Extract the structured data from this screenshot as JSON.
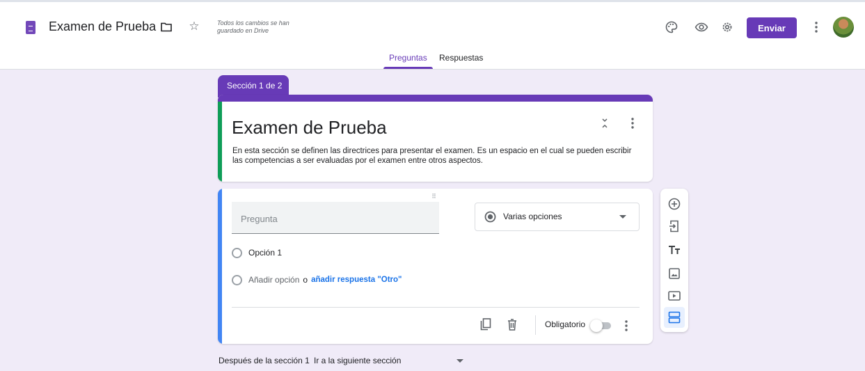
{
  "header": {
    "form_title": "Examen de Prueba",
    "saved_status": "Todos los cambios se han guardado en Drive",
    "send_label": "Enviar",
    "icons": [
      "forms-logo-icon",
      "folder-icon",
      "star-icon",
      "palette-icon",
      "eye-icon",
      "gear-icon",
      "more-vert-icon"
    ],
    "accent_color": "#673ab7"
  },
  "tabs": [
    {
      "label": "Preguntas",
      "active": true
    },
    {
      "label": "Respuestas",
      "active": false
    }
  ],
  "section": {
    "tab_label": "Sección 1 de 2",
    "title": "Examen de Prueba",
    "description": "En esta sección se definen las directrices para presentar el examen. Es un espacio en el cual se pueden escribir las competencias a ser evaluadas por el examen entre otros aspectos."
  },
  "question": {
    "placeholder": "Pregunta",
    "type": "Varias opciones",
    "options": [
      "Opción 1"
    ],
    "add_option": "Añadir opción",
    "or": "o",
    "add_other": "añadir respuesta \"Otro\"",
    "required_label": "Obligatorio",
    "required": false
  },
  "toolbar": {
    "tools": [
      "add-question-icon",
      "import-questions-icon",
      "add-title-icon",
      "add-image-icon",
      "add-video-icon",
      "add-section-icon"
    ]
  },
  "after_section": {
    "label": "Después de la sección 1",
    "value": "Ir a la siguiente sección"
  }
}
